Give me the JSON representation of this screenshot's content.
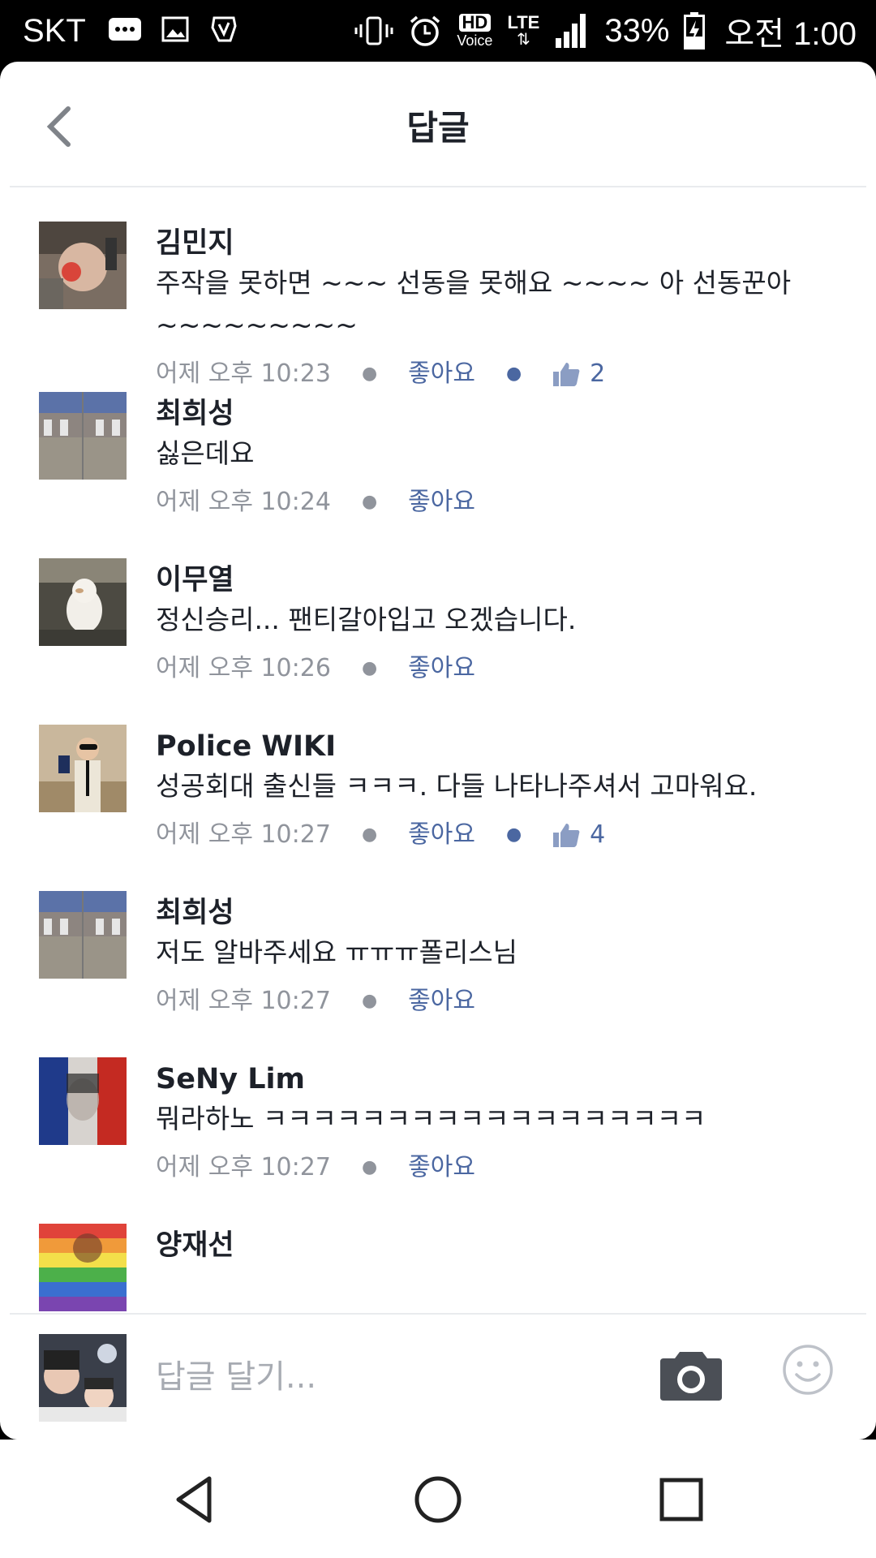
{
  "status_bar": {
    "carrier": "SKT",
    "left_icons": [
      "message-icon",
      "image-icon",
      "hand-icon"
    ],
    "right_icons": [
      "vibrate-icon",
      "alarm-icon",
      "hd-voice-icon",
      "lte-icon",
      "signal-icon",
      "battery-charging-icon"
    ],
    "hd_label": "HD",
    "voice_label": "Voice",
    "lte_label": "LTE",
    "battery_percent": "33%",
    "time": "오전 1:00"
  },
  "header": {
    "title": "답글",
    "back_icon": "chevron-left-icon"
  },
  "comments": [
    {
      "name": "김민지",
      "text": "주작을 못하면 ~~~ 선동을 못해요 ~~~~ 아 선동꾼아 ~~~~~~~~~",
      "time": "어제 오후 10:23",
      "like_label": "좋아요",
      "likes": "2"
    },
    {
      "name": "최희성",
      "text": "싫은데요",
      "time": "어제 오후 10:24",
      "like_label": "좋아요",
      "likes": ""
    },
    {
      "name": "이무열",
      "text": "정신승리... 팬티갈아입고 오겠습니다.",
      "time": "어제 오후 10:26",
      "like_label": "좋아요",
      "likes": ""
    },
    {
      "name": "Police WIKI",
      "text": "성공회대 출신들 ㅋㅋㅋ. 다들 나타나주셔서 고마워요.",
      "time": "어제 오후 10:27",
      "like_label": "좋아요",
      "likes": "4"
    },
    {
      "name": "최희성",
      "text": "저도 알바주세요 ㅠㅠㅠ폴리스님",
      "time": "어제 오후 10:27",
      "like_label": "좋아요",
      "likes": ""
    },
    {
      "name": "SeNy Lim",
      "text": "뭐라하노 ㅋㅋㅋㅋㅋㅋㅋㅋㅋㅋㅋㅋㅋㅋㅋㅋㅋㅋ",
      "time": "어제 오후 10:27",
      "like_label": "좋아요",
      "likes": ""
    },
    {
      "name": "양재선",
      "text": "",
      "time": "",
      "like_label": "",
      "likes": ""
    }
  ],
  "composer": {
    "placeholder": "답글 달기...",
    "camera_icon": "camera-icon",
    "emoji_icon": "smiley-icon"
  },
  "nav_bar": {
    "icons": [
      "back-triangle-icon",
      "home-circle-icon",
      "recents-square-icon"
    ]
  },
  "colors": {
    "link_blue": "#4b67a1",
    "meta_gray": "#90949c",
    "text_dark": "#1d2129",
    "divider": "#e9ebee"
  }
}
